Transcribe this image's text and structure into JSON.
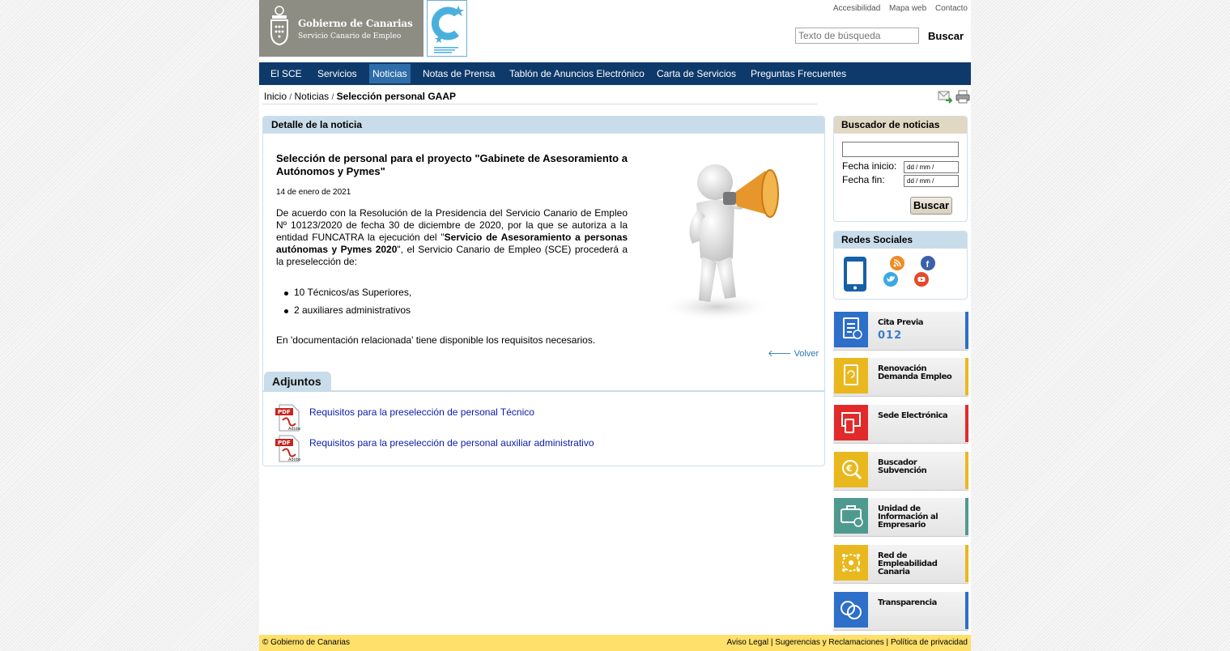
{
  "header": {
    "logo_title": "Gobierno de Canarias",
    "logo_subtitle": "Servicio Canario de Empleo",
    "top_links": [
      "Accesibilidad",
      "Mapa web",
      "Contacto"
    ],
    "search_placeholder": "Texto de búsqueda",
    "search_button": "Buscar"
  },
  "nav": {
    "items": [
      "El SCE",
      "Servicios",
      "Noticias",
      "Notas de Prensa",
      "Tablón de Anuncios Electrónico",
      "Carta de Servicios",
      "Preguntas Frecuentes"
    ],
    "active": "Noticias"
  },
  "breadcrumb": {
    "home": "Inicio",
    "section": "Noticias",
    "current": "Selección personal GAAP",
    "separator": "/"
  },
  "news": {
    "panel_title": "Detalle de la noticia",
    "title": "Selección de personal para el proyecto \"Gabinete de Asesoramiento a Autónomos y Pymes\"",
    "date": "14 de enero de 2021",
    "body_1": "De acuerdo con la Resolución de la Presidencia del Servicio Canario de Empleo Nº 10123/2020 de fecha 30 de diciembre de 2020, por la que se autoriza a la entidad FUNCATRA la ejecución del \"",
    "body_bold": "Servicio de Asesoramiento a personas autónomas y Pymes 2020",
    "body_2": "\", el Servicio Canario de Empleo (SCE) procederá a la preselección de:",
    "list": [
      "10 Técnicos/as Superiores,",
      "2 auxiliares administrativos"
    ],
    "footer_text": "En 'documentación relacionada' tiene disponible los requisitos necesarios.",
    "back_link": "Volver",
    "back_icon": "arrow-left-icon"
  },
  "attachments": {
    "title": "Adjuntos",
    "items": [
      "Requisitos para la preselección de personal Técnico",
      "Requisitos para la preselección de personal auxiliar administrativo"
    ]
  },
  "news_search": {
    "title": "Buscador de noticias",
    "start_label": "Fecha inicio:",
    "end_label": "Fecha fin:",
    "date_placeholder": "dd / mm /",
    "button": "Buscar"
  },
  "social": {
    "title": "Redes Sociales",
    "icons": [
      "mobile-icon",
      "rss-icon",
      "facebook-icon",
      "twitter-icon",
      "youtube-icon"
    ]
  },
  "services": [
    {
      "label": "Cita Previa",
      "extra": "012",
      "color": "#2d6fc9",
      "icon": "appointment-icon"
    },
    {
      "label": "Renovación Demanda Empleo",
      "color": "#e8b81e",
      "icon": "renewal-icon"
    },
    {
      "label": "Sede Electrónica",
      "color": "#e32a2a",
      "icon": "devices-icon"
    },
    {
      "label": "Buscador Subvención",
      "color": "#e8b81e",
      "icon": "euro-search-icon"
    },
    {
      "label": "Unidad de Información al Empresario",
      "color": "#4f9a8f",
      "icon": "briefcase-icon"
    },
    {
      "label": "Red de Empleabilidad Canaria",
      "color": "#e8b81e",
      "icon": "network-icon"
    },
    {
      "label": "Transparencia",
      "color": "#2d6fc9",
      "icon": "transparency-icon"
    }
  ],
  "footer": {
    "copyright": "© Gobierno de Canarias",
    "links": [
      "Aviso Legal",
      "Sugerencias y Reclamaciones",
      "Política de privacidad"
    ],
    "separator": "|"
  },
  "colors": {
    "nav": "#0e3a6b",
    "nav_active": "#2e6da8",
    "panel_head": "#c9dcea",
    "news_search_head": "#e1d8c3",
    "footer": "#ffe06a",
    "link": "#0a1ca8"
  }
}
